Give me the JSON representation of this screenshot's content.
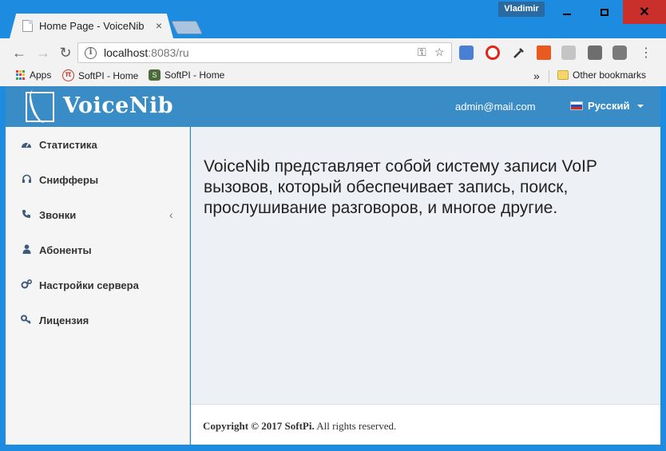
{
  "browser": {
    "tab_title": "Home Page - VoiceNib",
    "tab_close": "×",
    "profile_name": "Vladimir",
    "url_host": "localhost",
    "url_rest": ":8083/ru",
    "bookmarks": [
      {
        "label": "Apps"
      },
      {
        "label": "SoftPI - Home"
      },
      {
        "label": "SoftPI - Home"
      }
    ],
    "other_bookmarks": "Other bookmarks",
    "overflow": "»"
  },
  "app": {
    "brand": "VoiceNib",
    "user_email": "admin@mail.com",
    "language": "Русский",
    "accent_color": "#3a8cc6"
  },
  "sidebar": {
    "items": [
      {
        "label": "Статистика",
        "icon": "dashboard-icon"
      },
      {
        "label": "Снифферы",
        "icon": "headphones-icon"
      },
      {
        "label": "Звонки",
        "icon": "phone-icon",
        "expandable": true
      },
      {
        "label": "Абоненты",
        "icon": "user-icon"
      },
      {
        "label": "Настройки сервера",
        "icon": "gears-icon"
      },
      {
        "label": "Лицензия",
        "icon": "key-icon"
      }
    ]
  },
  "main": {
    "intro": "VoiceNib представляет собой систему записи VoIP вызовов, который обеспечивает запись, поиск, прослушивание разговоров, и многое другие."
  },
  "footer": {
    "copyright": "Copyright © 2017 SoftPi.",
    "rights": "All rights reserved."
  }
}
